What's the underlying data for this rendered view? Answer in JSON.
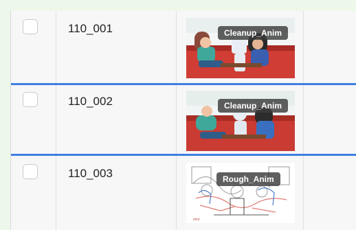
{
  "rows": [
    {
      "name": "110_001",
      "status": "Cleanup_Anim",
      "style": "color"
    },
    {
      "name": "110_002",
      "status": "Cleanup_Anim",
      "style": "color"
    },
    {
      "name": "110_003",
      "status": "Rough_Anim",
      "style": "rough"
    }
  ],
  "colors": {
    "accent": "#3f7fe0",
    "badge": "#3c3c3c"
  }
}
